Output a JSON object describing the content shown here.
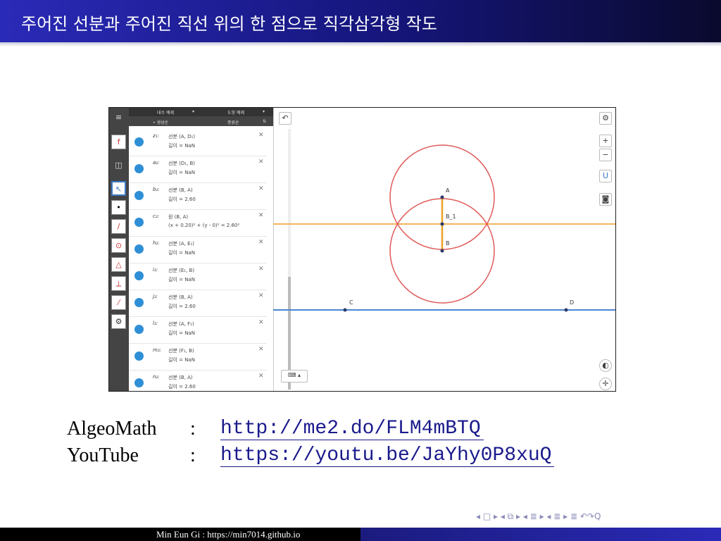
{
  "slide": {
    "title": "주어진 선분과 주어진 직선 위의 한 점으로 직각삼각형 작도"
  },
  "app": {
    "header_menus": [
      "대수 예제",
      "도형 예제"
    ],
    "header_sub": [
      "• 생성순",
      "종류순"
    ],
    "objects": [
      {
        "name": "z₁:",
        "def": "선분 (A, D₁)",
        "value": "길이 = NaN"
      },
      {
        "name": "a₂:",
        "def": "선분 (D₁, B)",
        "value": "길이 = NaN"
      },
      {
        "name": "b₂:",
        "def": "선분 (B, A)",
        "value": "길이 = 2.60"
      },
      {
        "name": "c₂:",
        "def": "원 (B, A)",
        "value": "(x + 0.20)² + (y - 0)² = 2.60²"
      },
      {
        "name": "h₂:",
        "def": "선분 (A, E₁)",
        "value": "길이 = NaN"
      },
      {
        "name": "i₂:",
        "def": "선분 (E₁, B)",
        "value": "길이 = NaN"
      },
      {
        "name": "j₂:",
        "def": "선분 (B, A)",
        "value": "길이 = 2.60"
      },
      {
        "name": "l₂:",
        "def": "선분 (A, F₁)",
        "value": "길이 = NaN"
      },
      {
        "name": "m₂:",
        "def": "선분 (F₁, B)",
        "value": "길이 = NaN"
      },
      {
        "name": "n₂:",
        "def": "선분 (B, A)",
        "value": "길이 = 2.60"
      }
    ],
    "point_labels": {
      "A": "A",
      "B1": "B_1",
      "B": "B",
      "C": "C",
      "D": "D"
    },
    "icons": [
      "menu-icon",
      "undo-icon",
      "settings-icon",
      "zoom-in-icon",
      "zoom-out-icon",
      "magnet-icon",
      "camera-icon",
      "keyboard-icon",
      "voice-icon",
      "move-icon"
    ],
    "colors": {
      "circle": "#e05a5a",
      "horizontal_line": "#f3b45a",
      "blue_line": "#4a86d4",
      "segment": "#f0a020",
      "point": "#2d3a66",
      "dot": "#2f8fd6"
    }
  },
  "links": [
    {
      "label": "AlgeoMath",
      "sep": ":",
      "url": "http://me2.do/FLM4mBTQ"
    },
    {
      "label": "YouTube",
      "sep": ":",
      "url": "https://youtu.be/JaYhy0P8xuQ"
    }
  ],
  "nav": "◂ □ ▸ ◂ ⧉ ▸ ◂ ≣ ▸ ◂ ≣ ▸   ≣   ↶↷Q",
  "footer": {
    "author": "Min Eun Gi : https://min7014.github.io"
  }
}
